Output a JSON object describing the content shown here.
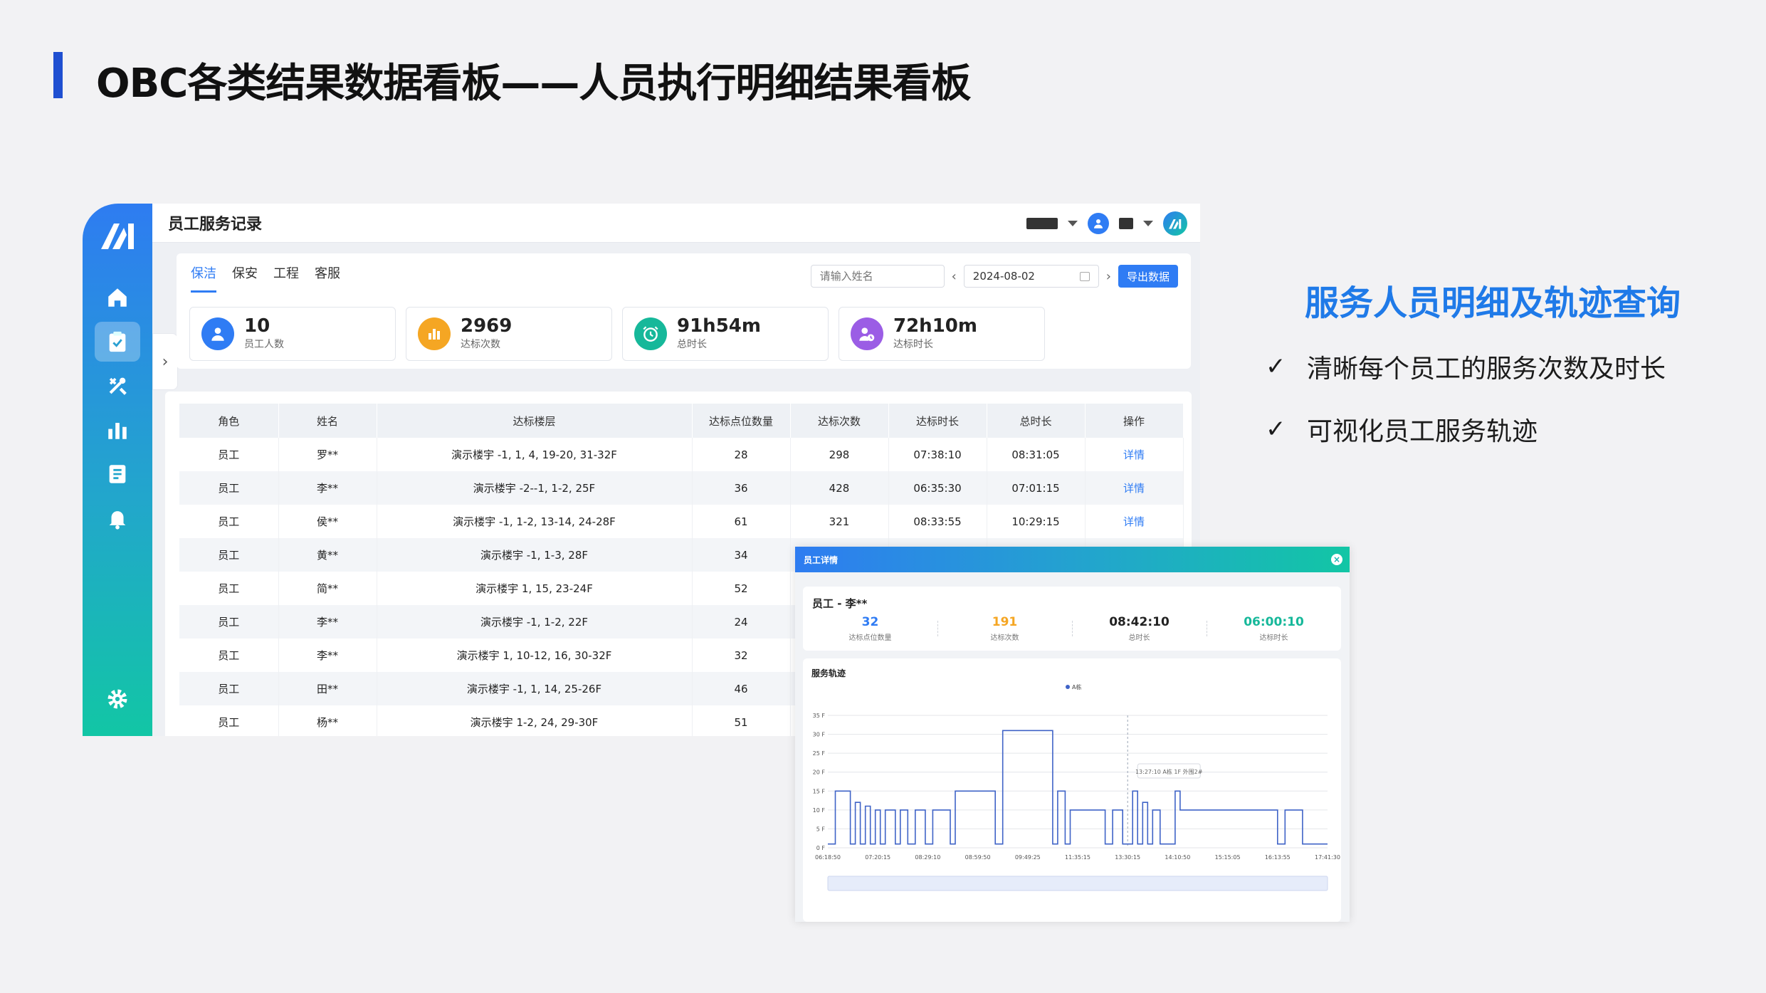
{
  "slide": {
    "title": "OBC各类结果数据看板——人员执行明细结果看板",
    "feature_title": "服务人员明细及轨迹查询",
    "bullets": [
      "清晰每个员工的服务次数及时长",
      "可视化员工服务轨迹"
    ],
    "check_glyph": "✓",
    "accent_color": "#1f4fd1",
    "feature_color": "#1f7ae8"
  },
  "app": {
    "title": "员工服务记录",
    "sidebar_icons": [
      "home-icon",
      "clipboard-check-icon",
      "tools-icon",
      "bar-chart-icon",
      "document-list-icon",
      "bell-icon",
      "settings-icon"
    ],
    "tabs": [
      "保洁",
      "保安",
      "工程",
      "客服"
    ],
    "active_tab": "保洁",
    "search": {
      "placeholder": "请输入姓名"
    },
    "date": "2024-08-02",
    "prev_glyph": "‹",
    "next_glyph": "›",
    "collapse_glyph": "›",
    "export_label": "导出数据",
    "primary_color": "#2f7cf4"
  },
  "stats": [
    {
      "value": "10",
      "label": "员工人数",
      "icon": "user-icon",
      "color": "#2f7cf4"
    },
    {
      "value": "2969",
      "label": "达标次数",
      "icon": "bar-chart-icon",
      "color": "#f5a623"
    },
    {
      "value": "91h54m",
      "label": "总时长",
      "icon": "alarm-clock-icon",
      "color": "#16b89a"
    },
    {
      "value": "72h10m",
      "label": "达标时长",
      "icon": "user-clock-icon",
      "color": "#9b5de5"
    }
  ],
  "table": {
    "columns": [
      "角色",
      "姓名",
      "达标楼层",
      "达标点位数量",
      "达标次数",
      "达标时长",
      "总时长",
      "操作"
    ],
    "rows": [
      [
        "员工",
        "罗**",
        "演示楼宇 -1, 1, 4, 19-20, 31-32F",
        "28",
        "298",
        "07:38:10",
        "08:31:05",
        "详情"
      ],
      [
        "员工",
        "李**",
        "演示楼宇 -2--1, 1-2, 25F",
        "36",
        "428",
        "06:35:30",
        "07:01:15",
        "详情"
      ],
      [
        "员工",
        "侯**",
        "演示楼宇 -1, 1-2, 13-14, 24-28F",
        "61",
        "321",
        "08:33:55",
        "10:29:15",
        "详情"
      ],
      [
        "员工",
        "黄**",
        "演示楼宇 -1, 1-3, 28F",
        "34",
        "",
        "",
        "",
        ""
      ],
      [
        "员工",
        "简**",
        "演示楼宇 1, 15, 23-24F",
        "52",
        "",
        "",
        "",
        ""
      ],
      [
        "员工",
        "李**",
        "演示楼宇 -1, 1-2, 22F",
        "24",
        "",
        "",
        "",
        ""
      ],
      [
        "员工",
        "李**",
        "演示楼宇 1, 10-12, 16, 30-32F",
        "32",
        "",
        "",
        "",
        ""
      ],
      [
        "员工",
        "田**",
        "演示楼宇 -1, 1, 14, 25-26F",
        "46",
        "",
        "",
        "",
        ""
      ],
      [
        "员工",
        "杨**",
        "演示楼宇 1-2, 24, 29-30F",
        "51",
        "",
        "",
        "",
        ""
      ]
    ]
  },
  "popup": {
    "title": "员工详情",
    "close_glyph": "×",
    "employee": "员工 - 李**",
    "metrics": [
      {
        "value": "32",
        "label": "达标点位数量",
        "color": "#2f7cf4"
      },
      {
        "value": "191",
        "label": "达标次数",
        "color": "#f5a623"
      },
      {
        "value": "08:42:10",
        "label": "总时长",
        "color": "#222222"
      },
      {
        "value": "06:00:10",
        "label": "达标时长",
        "color": "#16b89a"
      }
    ],
    "trajectory_title": "服务轨迹"
  },
  "chart_data": {
    "type": "line",
    "step": true,
    "legend": [
      "A栋"
    ],
    "legend_position": "top-center",
    "y_ticks": [
      "0 F",
      "5 F",
      "10 F",
      "15 F",
      "20 F",
      "25 F",
      "30 F",
      "35 F"
    ],
    "ylim": [
      0,
      35
    ],
    "x_ticks": [
      "06:18:50",
      "07:20:15",
      "08:29:10",
      "08:59:50",
      "09:49:25",
      "11:35:15",
      "13:30:15",
      "14:10:50",
      "15:15:05",
      "16:13:55",
      "17:41:30"
    ],
    "xlim": [
      0,
      10
    ],
    "grid": true,
    "line_color": "#3f63c7",
    "tooltip": {
      "text": "13:27:10 A栋 1F 外围2#",
      "x": 6.0
    },
    "series": [
      {
        "values": [
          [
            0,
            1
          ],
          [
            0.15,
            1
          ],
          [
            0.15,
            15
          ],
          [
            0.45,
            15
          ],
          [
            0.45,
            1
          ],
          [
            0.55,
            1
          ],
          [
            0.55,
            12
          ],
          [
            0.65,
            12
          ],
          [
            0.65,
            1
          ],
          [
            0.75,
            1
          ],
          [
            0.75,
            11
          ],
          [
            0.85,
            11
          ],
          [
            0.85,
            1
          ],
          [
            0.95,
            1
          ],
          [
            0.95,
            10
          ],
          [
            1.05,
            10
          ],
          [
            1.05,
            1
          ],
          [
            1.15,
            1
          ],
          [
            1.15,
            10
          ],
          [
            1.35,
            10
          ],
          [
            1.35,
            1
          ],
          [
            1.45,
            1
          ],
          [
            1.45,
            10
          ],
          [
            1.6,
            10
          ],
          [
            1.6,
            1
          ],
          [
            1.75,
            1
          ],
          [
            1.75,
            10
          ],
          [
            1.95,
            10
          ],
          [
            1.95,
            1
          ],
          [
            2.1,
            1
          ],
          [
            2.1,
            10
          ],
          [
            2.45,
            10
          ],
          [
            2.45,
            1
          ],
          [
            2.55,
            1
          ],
          [
            2.55,
            15
          ],
          [
            3.35,
            15
          ],
          [
            3.35,
            1
          ],
          [
            3.5,
            1
          ],
          [
            3.5,
            31
          ],
          [
            4.5,
            31
          ],
          [
            4.5,
            1
          ],
          [
            4.6,
            1
          ],
          [
            4.6,
            15
          ],
          [
            4.75,
            15
          ],
          [
            4.75,
            1
          ],
          [
            4.85,
            1
          ],
          [
            4.85,
            10
          ],
          [
            5.55,
            10
          ],
          [
            5.55,
            1
          ],
          [
            5.7,
            1
          ],
          [
            5.7,
            10
          ],
          [
            5.9,
            10
          ],
          [
            5.9,
            1
          ],
          [
            6.1,
            1
          ],
          [
            6.1,
            15
          ],
          [
            6.2,
            15
          ],
          [
            6.2,
            1
          ],
          [
            6.3,
            1
          ],
          [
            6.3,
            12
          ],
          [
            6.4,
            12
          ],
          [
            6.4,
            1
          ],
          [
            6.5,
            1
          ],
          [
            6.5,
            10
          ],
          [
            6.65,
            10
          ],
          [
            6.65,
            1
          ],
          [
            6.95,
            1
          ],
          [
            6.95,
            15
          ],
          [
            7.05,
            15
          ],
          [
            7.05,
            10
          ],
          [
            9.0,
            10
          ],
          [
            9.0,
            1
          ],
          [
            9.15,
            1
          ],
          [
            9.15,
            10
          ],
          [
            9.5,
            10
          ],
          [
            9.5,
            1
          ],
          [
            10,
            1
          ]
        ]
      }
    ]
  }
}
